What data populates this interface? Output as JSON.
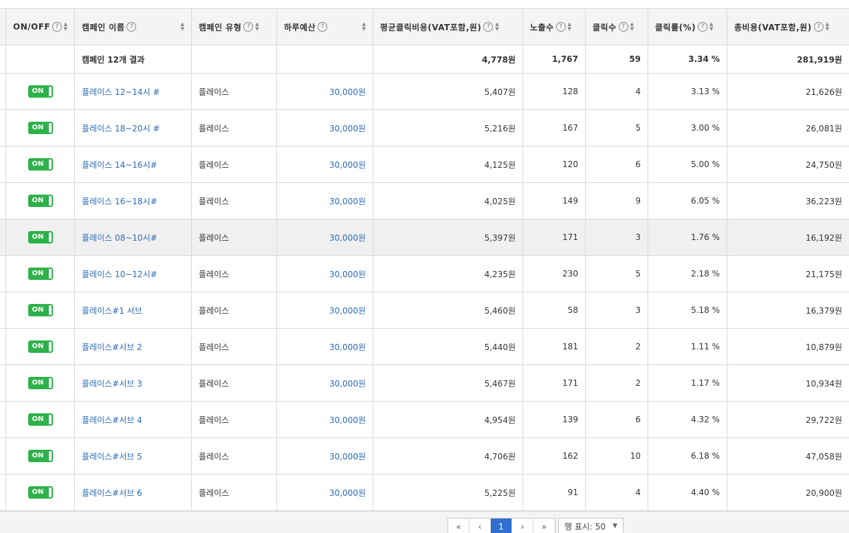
{
  "columns": [
    {
      "label": "ON/OFF"
    },
    {
      "label": "캠페인 이름"
    },
    {
      "label": "캠페인 유형"
    },
    {
      "label": "하루예산"
    },
    {
      "label": "평균클릭비용(VAT포함,원)"
    },
    {
      "label": "노출수"
    },
    {
      "label": "클릭수"
    },
    {
      "label": "클릭률(%)"
    },
    {
      "label": "총비용(VAT포함,원)"
    }
  ],
  "help_glyph": "?",
  "summary": {
    "label": "캠페인 12개 결과",
    "avg_cpc": "4,778원",
    "impressions": "1,767",
    "clicks": "59",
    "ctr": "3.34 %",
    "cost": "281,919원"
  },
  "toggle_label": "ON",
  "rows": [
    {
      "name": "플레이스 12~14시 #",
      "type": "플레이스",
      "budget": "30,000원",
      "avg_cpc": "5,407원",
      "impressions": "128",
      "clicks": "4",
      "ctr": "3.13 %",
      "cost": "21,626원"
    },
    {
      "name": "플레이스 18~20시 #",
      "type": "플레이스",
      "budget": "30,000원",
      "avg_cpc": "5,216원",
      "impressions": "167",
      "clicks": "5",
      "ctr": "3.00 %",
      "cost": "26,081원"
    },
    {
      "name": "플레이스 14~16시#",
      "type": "플레이스",
      "budget": "30,000원",
      "avg_cpc": "4,125원",
      "impressions": "120",
      "clicks": "6",
      "ctr": "5.00 %",
      "cost": "24,750원"
    },
    {
      "name": "플레이스 16~18시#",
      "type": "플레이스",
      "budget": "30,000원",
      "avg_cpc": "4,025원",
      "impressions": "149",
      "clicks": "9",
      "ctr": "6.05 %",
      "cost": "36,223원"
    },
    {
      "name": "플레이스 08~10시#",
      "type": "플레이스",
      "budget": "30,000원",
      "avg_cpc": "5,397원",
      "impressions": "171",
      "clicks": "3",
      "ctr": "1.76 %",
      "cost": "16,192원"
    },
    {
      "name": "플레이스 10~12시#",
      "type": "플레이스",
      "budget": "30,000원",
      "avg_cpc": "4,235원",
      "impressions": "230",
      "clicks": "5",
      "ctr": "2.18 %",
      "cost": "21,175원"
    },
    {
      "name": "플레이스#1 서브",
      "type": "플레이스",
      "budget": "30,000원",
      "avg_cpc": "5,460원",
      "impressions": "58",
      "clicks": "3",
      "ctr": "5.18 %",
      "cost": "16,379원"
    },
    {
      "name": "플레이스#서브 2",
      "type": "플레이스",
      "budget": "30,000원",
      "avg_cpc": "5,440원",
      "impressions": "181",
      "clicks": "2",
      "ctr": "1.11 %",
      "cost": "10,879원"
    },
    {
      "name": "플레이스#서브 3",
      "type": "플레이스",
      "budget": "30,000원",
      "avg_cpc": "5,467원",
      "impressions": "171",
      "clicks": "2",
      "ctr": "1.17 %",
      "cost": "10,934원"
    },
    {
      "name": "플레이스#서브 4",
      "type": "플레이스",
      "budget": "30,000원",
      "avg_cpc": "4,954원",
      "impressions": "139",
      "clicks": "6",
      "ctr": "4.32 %",
      "cost": "29,722원"
    },
    {
      "name": "플레이스#서브 5",
      "type": "플레이스",
      "budget": "30,000원",
      "avg_cpc": "4,706원",
      "impressions": "162",
      "clicks": "10",
      "ctr": "6.18 %",
      "cost": "47,058원"
    },
    {
      "name": "플레이스#서브 6",
      "type": "플레이스",
      "budget": "30,000원",
      "avg_cpc": "5,225원",
      "impressions": "91",
      "clicks": "4",
      "ctr": "4.40 %",
      "cost": "20,900원"
    }
  ],
  "pagination": {
    "first": "«",
    "prev": "‹",
    "current": "1",
    "next": "›",
    "last": "»",
    "rows_label": "행 표시: 50"
  },
  "colors": {
    "toggle_on": "#2db24a",
    "link": "#2a6ab5",
    "active_page": "#2f6fd1"
  }
}
